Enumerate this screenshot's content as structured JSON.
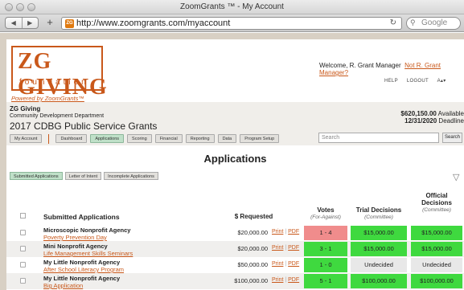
{
  "browser": {
    "window_title": "ZoomGrants ™ - My Account",
    "back": "◀",
    "forward": "▶",
    "plus": "+",
    "favicon": "ZG",
    "url": "http://www.zoomgrants.com/myaccount",
    "reload": "↻",
    "search_icon": "⚲",
    "search_placeholder": "Google"
  },
  "header": {
    "logo_main": "ZG GIVING",
    "logo_sub": "foundation",
    "powered_by": "Powered by ZoomGrants™",
    "welcome_text": "Welcome, R. Grant Manager",
    "not_user_link": "Not R. Grant Manager?",
    "util_links": [
      "HELP",
      "LOGOUT",
      "A▴▾"
    ]
  },
  "org": {
    "name": "ZG Giving",
    "department": "Community Development Department",
    "program": "2017 CDBG Public Service Grants",
    "available_amount": "$620,150.00",
    "available_label": "Available",
    "deadline_date": "12/31/2020",
    "deadline_label": "Deadline"
  },
  "nav": {
    "my_account": "My Account",
    "tabs": [
      "Dashboard",
      "Applications",
      "Scoring",
      "Financial",
      "Reporting",
      "Data",
      "Program Setup"
    ],
    "active_tab": "Applications",
    "search_placeholder": "Search",
    "search_button": "Search"
  },
  "main": {
    "title": "Applications",
    "subtabs": [
      "Submitted Applications",
      "Letter of Intent",
      "Incomplete Applications"
    ],
    "active_subtab": "Submitted Applications",
    "filter_icon": "filter-icon"
  },
  "table": {
    "headers": {
      "submitted": "Submitted Applications",
      "requested": "$ Requested",
      "votes": "Votes",
      "votes_sub": "(For-Against)",
      "trial": "Trial Decisions",
      "trial_sub": "(Committee)",
      "official_1": "Official",
      "official_2": "Decisions",
      "official_sub": "(Committee)"
    },
    "print_label": "Print",
    "pdf_label": "PDF",
    "separator": "|",
    "rows": [
      {
        "org": "Microscopic Nonprofit Agency",
        "project": "Poverty Prevention Day",
        "amount": "$20,000.00",
        "votes": "1 - 4",
        "votes_color": "#f08c8c",
        "trial": "$15,000.00",
        "trial_color": "#3fd93f",
        "official": "$15,000.00",
        "official_color": "#3fd93f"
      },
      {
        "org": "Mini Nonprofit Agency",
        "project": "Life Management Skills Seminars",
        "amount": "$20,000.00",
        "votes": "3 - 1",
        "votes_color": "#3fd93f",
        "trial": "$15,000.00",
        "trial_color": "#3fd93f",
        "official": "$15,000.00",
        "official_color": "#3fd93f"
      },
      {
        "org": "My Little Nonprofit Agency",
        "project": "After School Literacy Program",
        "amount": "$50,000.00",
        "votes": "1 - 0",
        "votes_color": "#3fd93f",
        "trial": "Undecided",
        "trial_color": "#e8e8e8",
        "official": "Undecided",
        "official_color": "#e8e8e8"
      },
      {
        "org": "My Little Nonprofit Agency",
        "project": "Big Application",
        "amount": "$100,000.00",
        "votes": "5 - 1",
        "votes_color": "#3fd93f",
        "trial": "$100,000.00",
        "trial_color": "#3fd93f",
        "official": "$100,000.00",
        "official_color": "#3fd93f"
      }
    ]
  },
  "colors": {
    "brand": "#c9581a",
    "active_tab": "#bfe0c8"
  }
}
